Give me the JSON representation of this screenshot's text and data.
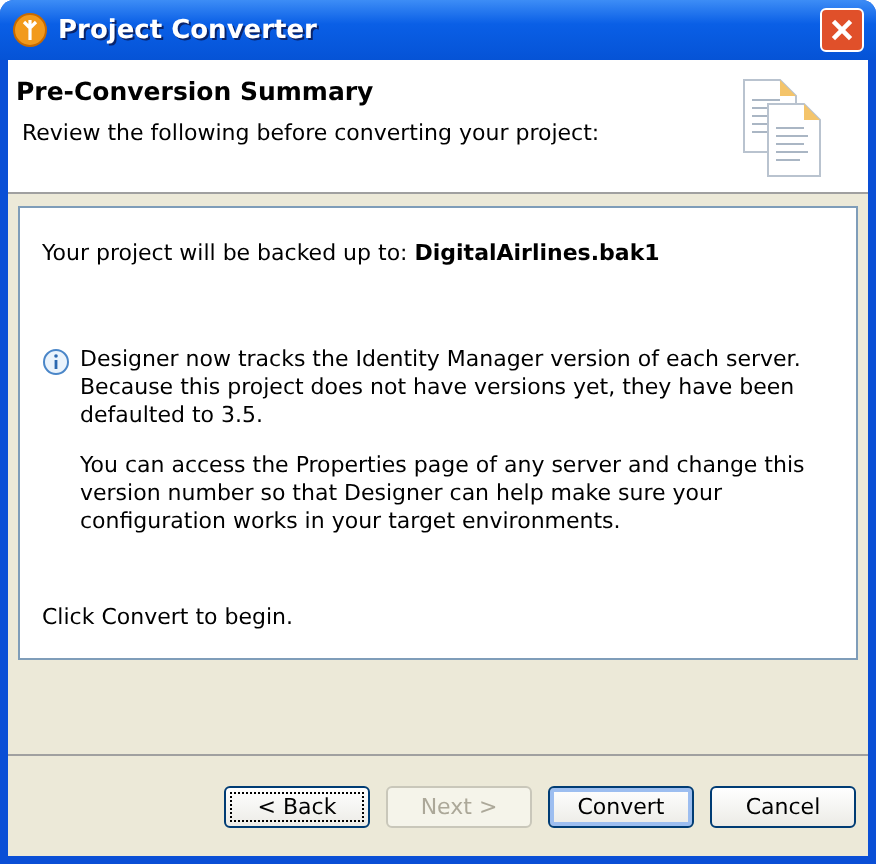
{
  "window": {
    "title": "Project Converter"
  },
  "header": {
    "title": "Pre-Conversion Summary",
    "subtitle": "Review the following before converting your project:"
  },
  "summary": {
    "backup_label": "Your project will be backed up to:",
    "backup_file": "DigitalAirlines.bak1",
    "info": [
      "Designer now tracks the Identity Manager version of each server. Because this project does not have versions yet, they have been defaulted to 3.5.",
      "You can access the Properties page of any server and change this version number so that Designer can help make sure your configuration works in your target environments."
    ],
    "footer": "Click Convert to begin."
  },
  "buttons": [
    {
      "label": "< Back",
      "disabled": false,
      "default": false,
      "focused": true
    },
    {
      "label": "Next >",
      "disabled": true,
      "default": false,
      "focused": false
    },
    {
      "label": "Convert",
      "disabled": false,
      "default": true,
      "focused": false
    },
    {
      "label": "Cancel",
      "disabled": false,
      "default": false,
      "focused": false
    }
  ]
}
